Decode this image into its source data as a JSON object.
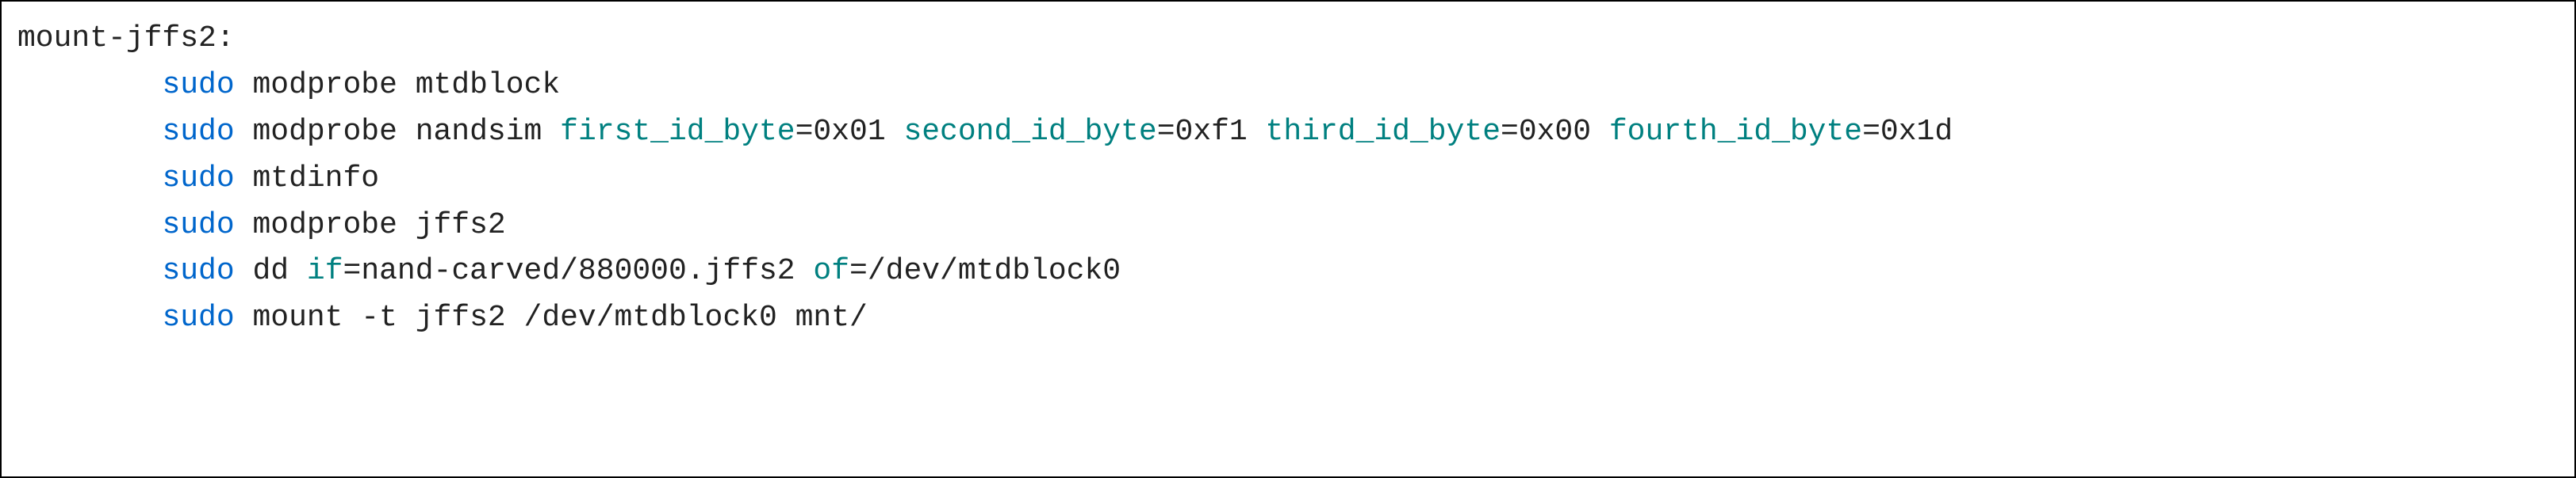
{
  "code": {
    "indent": "        ",
    "label": "mount-jffs2:",
    "lines": [
      {
        "sudo": "sudo",
        "rest": "modprobe mtdblock"
      },
      {
        "sudo": "sudo",
        "lead": "modprobe nandsim",
        "params": [
          {
            "name": "first_id_byte",
            "eq": "=",
            "val": "0x01"
          },
          {
            "name": "second_id_byte",
            "eq": "=",
            "val": "0xf1"
          },
          {
            "name": "third_id_byte",
            "eq": "=",
            "val": "0x00"
          },
          {
            "name": "fourth_id_byte",
            "eq": "=",
            "val": "0x1d"
          }
        ]
      },
      {
        "sudo": "sudo",
        "rest": "mtdinfo"
      },
      {
        "sudo": "sudo",
        "rest": "modprobe jffs2"
      },
      {
        "sudo": "sudo",
        "lead": "dd",
        "params": [
          {
            "name": "if",
            "eq": "=",
            "val": "nand-carved/880000.jffs2"
          },
          {
            "name": "of",
            "eq": "=",
            "val": "/dev/mtdblock0"
          }
        ]
      },
      {
        "sudo": "sudo",
        "rest": "mount -t jffs2 /dev/mtdblock0 mnt/"
      }
    ],
    "space": " "
  }
}
